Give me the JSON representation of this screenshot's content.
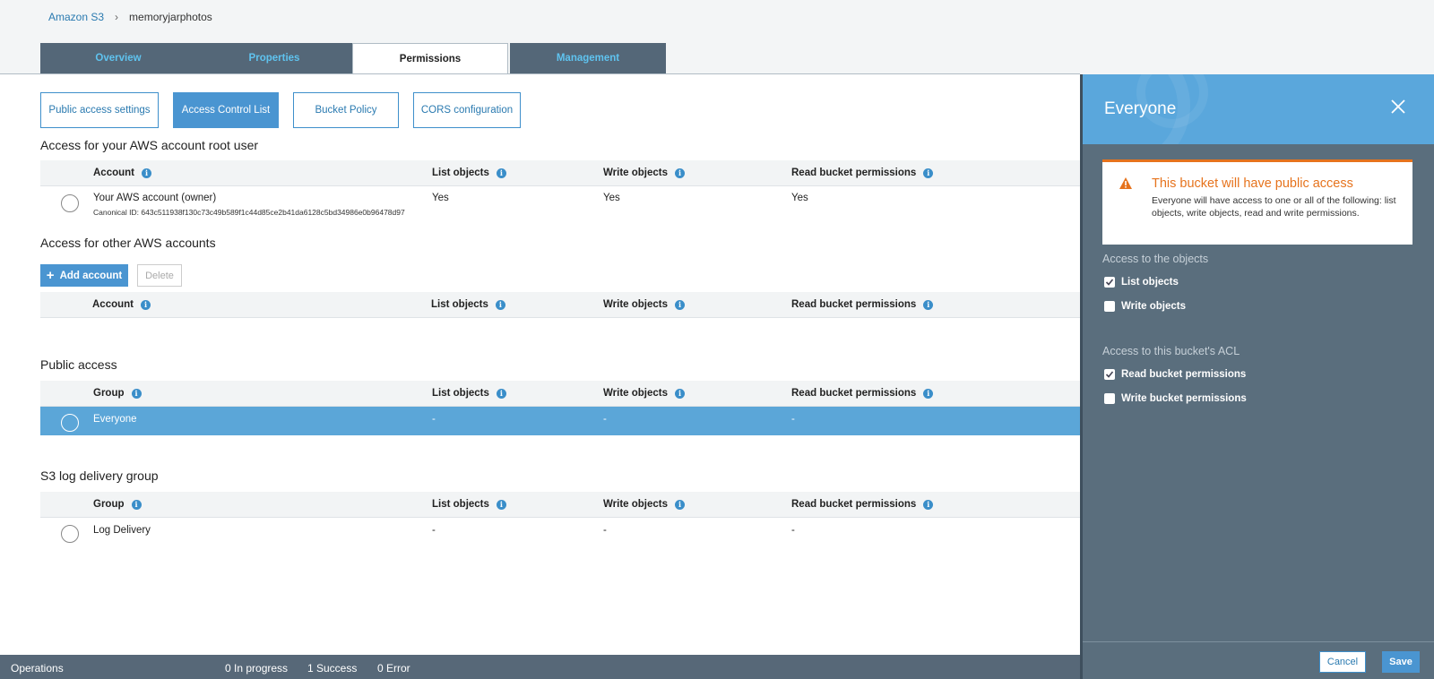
{
  "breadcrumb": {
    "root": "Amazon S3",
    "separator": "›",
    "bucket": "memoryjarphotos"
  },
  "tabs": [
    {
      "label": "Overview"
    },
    {
      "label": "Properties"
    },
    {
      "label": "Permissions"
    },
    {
      "label": "Management"
    }
  ],
  "subtabs": [
    {
      "label": "Public access settings"
    },
    {
      "label": "Access Control List"
    },
    {
      "label": "Bucket Policy"
    },
    {
      "label": "CORS configuration"
    }
  ],
  "columns": {
    "account": "Account",
    "group": "Group",
    "list": "List objects",
    "write": "Write objects",
    "read": "Read bucket permissions",
    "info_glyph": "i"
  },
  "root_section": {
    "title": "Access for your AWS account root user",
    "row": {
      "name": "Your AWS account (owner)",
      "canonical": "Canonical ID: 643c511938f130c73c49b589f1c44d85ce2b41da6128c5bd34986e0b96478d97",
      "list": "Yes",
      "write": "Yes",
      "read": "Yes"
    }
  },
  "other_section": {
    "title": "Access for other AWS accounts",
    "add_label": "Add account",
    "add_glyph": "+",
    "delete_label": "Delete"
  },
  "public_section": {
    "title": "Public access",
    "row": {
      "name": "Everyone",
      "list": "-",
      "write": "-",
      "read": "-"
    }
  },
  "log_section": {
    "title": "S3 log delivery group",
    "row": {
      "name": "Log Delivery",
      "list": "-",
      "write": "-",
      "read": "-"
    }
  },
  "footer": {
    "operations": "Operations",
    "in_progress": "0 In progress",
    "success": "1 Success",
    "error": "0 Error"
  },
  "panel": {
    "title": "Everyone",
    "alert_title": "This bucket will have public access",
    "alert_body": "Everyone will have access to one or all of the following: list objects, write objects, read and write permissions.",
    "objects_label": "Access to the objects",
    "acl_label": "Access to this bucket's ACL",
    "options": {
      "list_objects": {
        "label": "List objects",
        "checked": true
      },
      "write_objects": {
        "label": "Write objects",
        "checked": false
      },
      "read_perms": {
        "label": "Read bucket permissions",
        "checked": true
      },
      "write_perms": {
        "label": "Write bucket permissions",
        "checked": false
      }
    },
    "cancel_label": "Cancel",
    "save_label": "Save"
  },
  "colors": {
    "accent": "#4a95d1",
    "tab_bg": "#546778",
    "panel_bg": "#5a6e7d",
    "warning": "#e6731d"
  }
}
